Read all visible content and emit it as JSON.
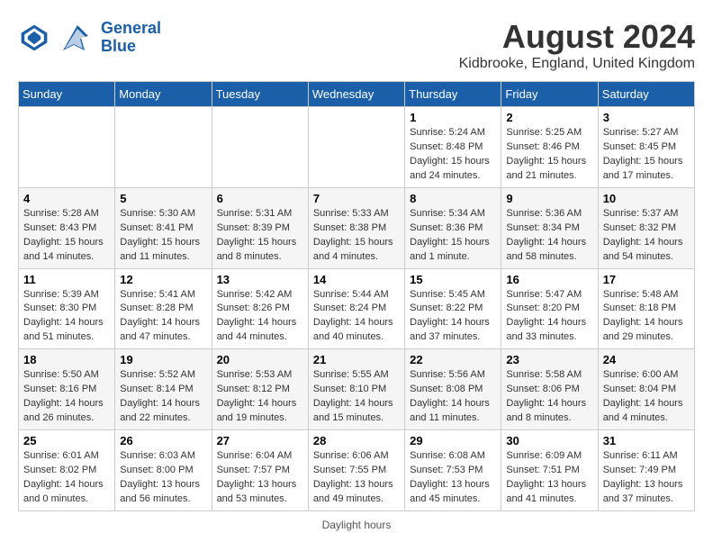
{
  "logo": {
    "line1": "General",
    "line2": "Blue"
  },
  "title": "August 2024",
  "subtitle": "Kidbrooke, England, United Kingdom",
  "days_of_week": [
    "Sunday",
    "Monday",
    "Tuesday",
    "Wednesday",
    "Thursday",
    "Friday",
    "Saturday"
  ],
  "weeks": [
    [
      {
        "num": "",
        "info": ""
      },
      {
        "num": "",
        "info": ""
      },
      {
        "num": "",
        "info": ""
      },
      {
        "num": "",
        "info": ""
      },
      {
        "num": "1",
        "info": "Sunrise: 5:24 AM\nSunset: 8:48 PM\nDaylight: 15 hours\nand 24 minutes."
      },
      {
        "num": "2",
        "info": "Sunrise: 5:25 AM\nSunset: 8:46 PM\nDaylight: 15 hours\nand 21 minutes."
      },
      {
        "num": "3",
        "info": "Sunrise: 5:27 AM\nSunset: 8:45 PM\nDaylight: 15 hours\nand 17 minutes."
      }
    ],
    [
      {
        "num": "4",
        "info": "Sunrise: 5:28 AM\nSunset: 8:43 PM\nDaylight: 15 hours\nand 14 minutes."
      },
      {
        "num": "5",
        "info": "Sunrise: 5:30 AM\nSunset: 8:41 PM\nDaylight: 15 hours\nand 11 minutes."
      },
      {
        "num": "6",
        "info": "Sunrise: 5:31 AM\nSunset: 8:39 PM\nDaylight: 15 hours\nand 8 minutes."
      },
      {
        "num": "7",
        "info": "Sunrise: 5:33 AM\nSunset: 8:38 PM\nDaylight: 15 hours\nand 4 minutes."
      },
      {
        "num": "8",
        "info": "Sunrise: 5:34 AM\nSunset: 8:36 PM\nDaylight: 15 hours\nand 1 minute."
      },
      {
        "num": "9",
        "info": "Sunrise: 5:36 AM\nSunset: 8:34 PM\nDaylight: 14 hours\nand 58 minutes."
      },
      {
        "num": "10",
        "info": "Sunrise: 5:37 AM\nSunset: 8:32 PM\nDaylight: 14 hours\nand 54 minutes."
      }
    ],
    [
      {
        "num": "11",
        "info": "Sunrise: 5:39 AM\nSunset: 8:30 PM\nDaylight: 14 hours\nand 51 minutes."
      },
      {
        "num": "12",
        "info": "Sunrise: 5:41 AM\nSunset: 8:28 PM\nDaylight: 14 hours\nand 47 minutes."
      },
      {
        "num": "13",
        "info": "Sunrise: 5:42 AM\nSunset: 8:26 PM\nDaylight: 14 hours\nand 44 minutes."
      },
      {
        "num": "14",
        "info": "Sunrise: 5:44 AM\nSunset: 8:24 PM\nDaylight: 14 hours\nand 40 minutes."
      },
      {
        "num": "15",
        "info": "Sunrise: 5:45 AM\nSunset: 8:22 PM\nDaylight: 14 hours\nand 37 minutes."
      },
      {
        "num": "16",
        "info": "Sunrise: 5:47 AM\nSunset: 8:20 PM\nDaylight: 14 hours\nand 33 minutes."
      },
      {
        "num": "17",
        "info": "Sunrise: 5:48 AM\nSunset: 8:18 PM\nDaylight: 14 hours\nand 29 minutes."
      }
    ],
    [
      {
        "num": "18",
        "info": "Sunrise: 5:50 AM\nSunset: 8:16 PM\nDaylight: 14 hours\nand 26 minutes."
      },
      {
        "num": "19",
        "info": "Sunrise: 5:52 AM\nSunset: 8:14 PM\nDaylight: 14 hours\nand 22 minutes."
      },
      {
        "num": "20",
        "info": "Sunrise: 5:53 AM\nSunset: 8:12 PM\nDaylight: 14 hours\nand 19 minutes."
      },
      {
        "num": "21",
        "info": "Sunrise: 5:55 AM\nSunset: 8:10 PM\nDaylight: 14 hours\nand 15 minutes."
      },
      {
        "num": "22",
        "info": "Sunrise: 5:56 AM\nSunset: 8:08 PM\nDaylight: 14 hours\nand 11 minutes."
      },
      {
        "num": "23",
        "info": "Sunrise: 5:58 AM\nSunset: 8:06 PM\nDaylight: 14 hours\nand 8 minutes."
      },
      {
        "num": "24",
        "info": "Sunrise: 6:00 AM\nSunset: 8:04 PM\nDaylight: 14 hours\nand 4 minutes."
      }
    ],
    [
      {
        "num": "25",
        "info": "Sunrise: 6:01 AM\nSunset: 8:02 PM\nDaylight: 14 hours\nand 0 minutes."
      },
      {
        "num": "26",
        "info": "Sunrise: 6:03 AM\nSunset: 8:00 PM\nDaylight: 13 hours\nand 56 minutes."
      },
      {
        "num": "27",
        "info": "Sunrise: 6:04 AM\nSunset: 7:57 PM\nDaylight: 13 hours\nand 53 minutes."
      },
      {
        "num": "28",
        "info": "Sunrise: 6:06 AM\nSunset: 7:55 PM\nDaylight: 13 hours\nand 49 minutes."
      },
      {
        "num": "29",
        "info": "Sunrise: 6:08 AM\nSunset: 7:53 PM\nDaylight: 13 hours\nand 45 minutes."
      },
      {
        "num": "30",
        "info": "Sunrise: 6:09 AM\nSunset: 7:51 PM\nDaylight: 13 hours\nand 41 minutes."
      },
      {
        "num": "31",
        "info": "Sunrise: 6:11 AM\nSunset: 7:49 PM\nDaylight: 13 hours\nand 37 minutes."
      }
    ]
  ],
  "footer": "Daylight hours"
}
